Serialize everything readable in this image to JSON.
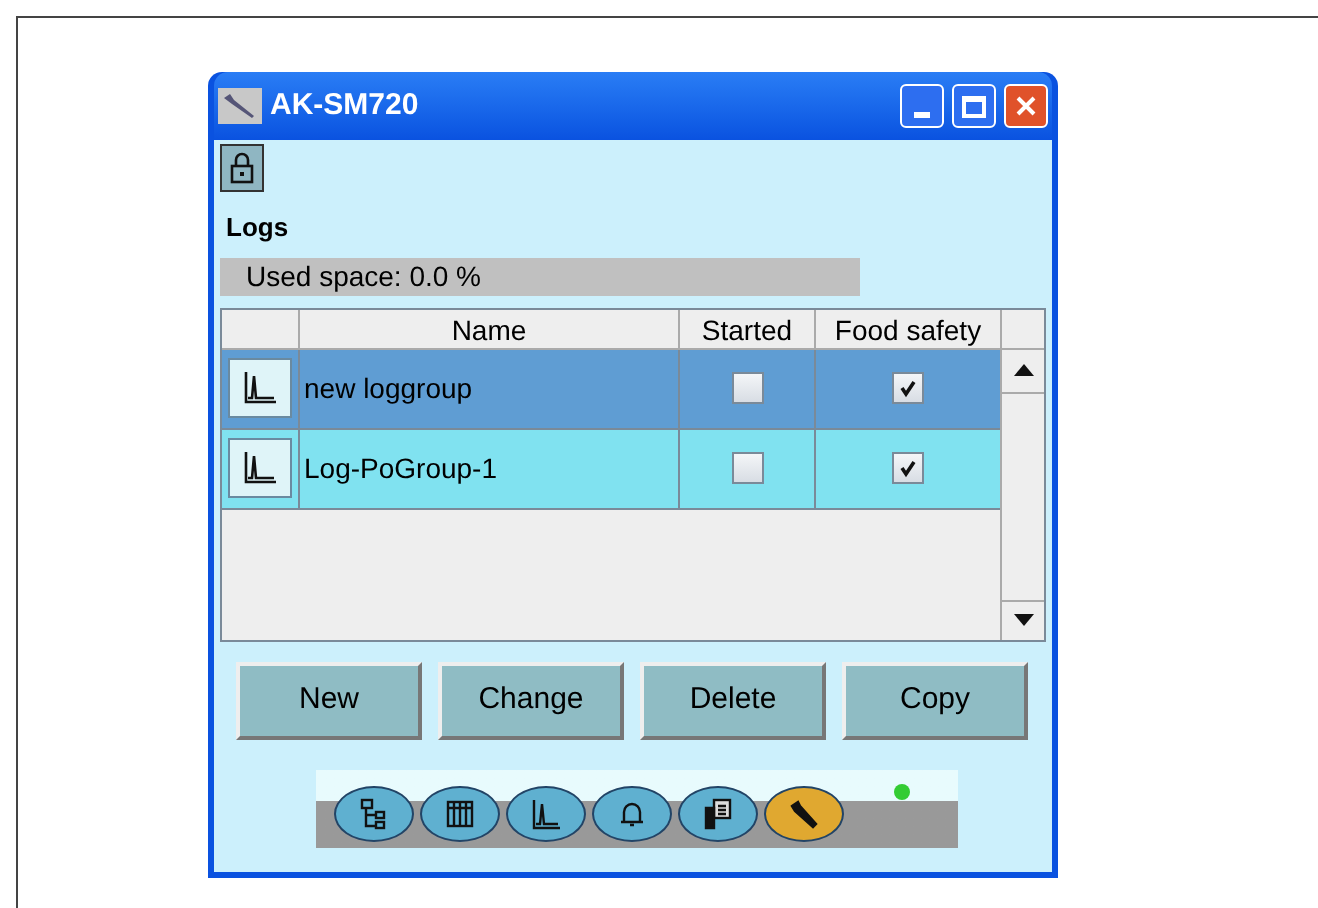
{
  "window": {
    "title": "AK-SM720"
  },
  "section_title": "Logs",
  "used_space": {
    "label": "Used space: 0.0 %"
  },
  "table": {
    "columns": [
      "Name",
      "Started",
      "Food safety"
    ],
    "rows": [
      {
        "name": "new loggroup",
        "selected": true,
        "started": false,
        "food_safety": true
      },
      {
        "name": "Log-PoGroup-1",
        "selected": false,
        "started": false,
        "food_safety": true
      }
    ]
  },
  "buttons": [
    "New",
    "Change",
    "Delete",
    "Copy"
  ],
  "toolbar": [
    {
      "kind": "tree",
      "selected": false
    },
    {
      "kind": "grid",
      "selected": false
    },
    {
      "kind": "graph",
      "selected": false
    },
    {
      "kind": "bell",
      "selected": false
    },
    {
      "kind": "device",
      "selected": false
    },
    {
      "kind": "wrench",
      "selected": true
    }
  ]
}
